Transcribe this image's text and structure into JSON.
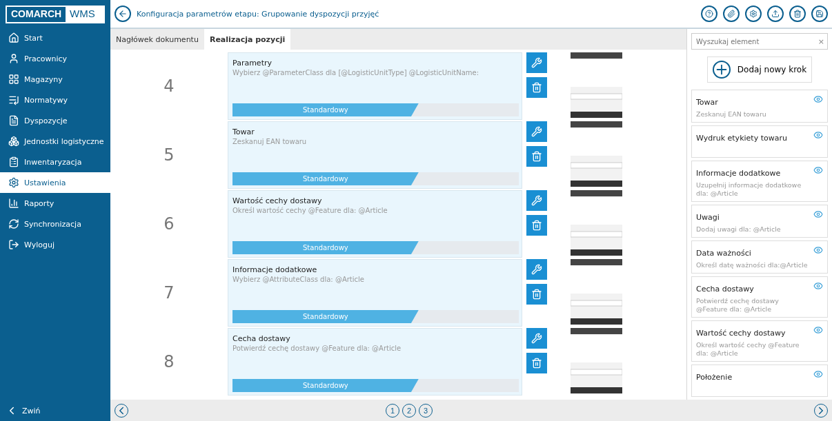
{
  "logo": {
    "left": "COMARCH",
    "right": "WMS"
  },
  "sidebar": {
    "items": [
      {
        "label": "Start",
        "selected": false
      },
      {
        "label": "Pracownicy",
        "selected": false
      },
      {
        "label": "Magazyny",
        "selected": false
      },
      {
        "label": "Normatywy",
        "selected": false
      },
      {
        "label": "Dyspozycje",
        "selected": false
      },
      {
        "label": "Jednostki logistyczne",
        "selected": false
      },
      {
        "label": "Inwentaryzacja",
        "selected": false
      },
      {
        "label": "Ustawienia",
        "selected": true
      },
      {
        "label": "Raporty",
        "selected": false
      },
      {
        "label": "Synchronizacja",
        "selected": false
      },
      {
        "label": "Wyloguj",
        "selected": false
      }
    ],
    "collapse": "Zwiń"
  },
  "header": {
    "title": "Konfiguracja parametrów etapu: Grupowanie dyspozycji przyjęć"
  },
  "tabs": [
    {
      "label": "Nagłówek dokumentu",
      "selected": false
    },
    {
      "label": "Realizacja pozycji",
      "selected": true
    }
  ],
  "steps": [
    {
      "number": "4",
      "title": "Parametry",
      "description": "Wybierz @ParameterClass dla [@LogisticUnitType] @LogisticUnitName:",
      "type": "Standardowy"
    },
    {
      "number": "5",
      "title": "Towar",
      "description": "Zeskanuj EAN towaru",
      "type": "Standardowy"
    },
    {
      "number": "6",
      "title": "Wartość cechy dostawy",
      "description": "Określ wartość cechy @Feature  dla: @Article",
      "type": "Standardowy"
    },
    {
      "number": "7",
      "title": "Informacje dodatkowe",
      "description": "Wybierz @AttributeClass  dla: @Article",
      "type": "Standardowy"
    },
    {
      "number": "8",
      "title": "Cecha dostawy",
      "description": "Potwierdź cechę dostawy @Feature dla: @Article",
      "type": "Standardowy"
    }
  ],
  "search": {
    "placeholder": "Wyszukaj element",
    "clear": "×"
  },
  "add_button": "Dodaj nowy krok",
  "elements": [
    {
      "title": "Towar",
      "description": "Zeskanuj EAN towaru"
    },
    {
      "title": "Wydruk etykiety towaru"
    },
    {
      "title": "Informacje dodatkowe",
      "description": "Uzupełnij informacje dodatkowe dla: @Article"
    },
    {
      "title": "Uwagi",
      "description": "Dodaj uwagi dla: @Article"
    },
    {
      "title": "Data ważności",
      "description": "Określ datę ważności  dla:@Article"
    },
    {
      "title": "Cecha dostawy",
      "description": "Potwierdź cechę dostawy @Feature dla: @Article"
    },
    {
      "title": "Wartość cechy dostawy",
      "description": "Określ wartość cechy @Feature  dla: @Article"
    },
    {
      "title": "Położenie"
    }
  ],
  "pagination": [
    {
      "label": "1"
    },
    {
      "label": "2"
    },
    {
      "label": "3"
    }
  ]
}
